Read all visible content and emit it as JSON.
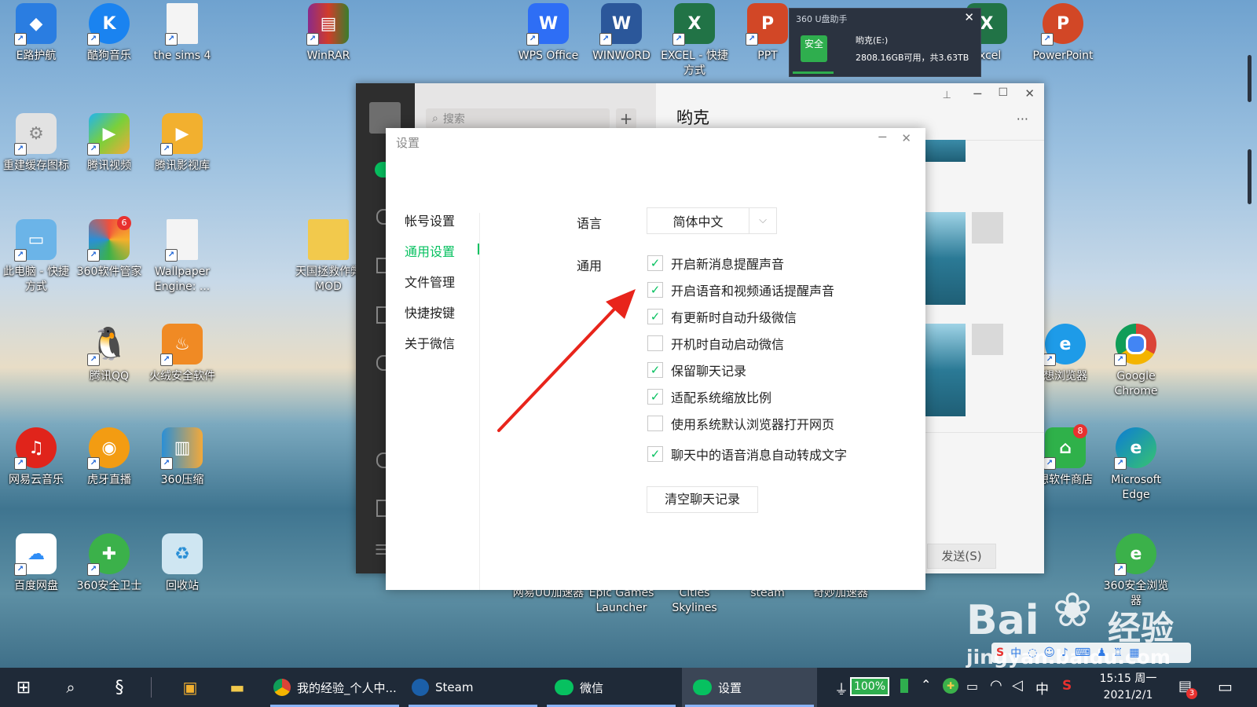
{
  "desktop": {
    "icons": [
      {
        "label": "E路护航",
        "color": "#2a7de1"
      },
      {
        "label": "酷狗音乐",
        "color": "#1a83f0"
      },
      {
        "label": "the sims 4",
        "color": "#eeeeee"
      },
      {
        "label": "WinRAR",
        "color": "#8a2b8a"
      },
      {
        "label": "WPS Office",
        "color": "#2e6ef5"
      },
      {
        "label": "WINWORD",
        "color": "#2b579a"
      },
      {
        "label": "EXCEL - 快捷方式",
        "color": "#217346"
      },
      {
        "label": "PPT",
        "color": "#d24726"
      },
      {
        "label": "excel",
        "color": "#217346"
      },
      {
        "label": "PowerPoint",
        "color": "#d24726"
      },
      {
        "label": "重建缓存图标",
        "color": "#dddddd"
      },
      {
        "label": "腾讯视频",
        "color": "#22b4ef"
      },
      {
        "label": "腾讯影视库",
        "color": "#f2b02f"
      },
      {
        "label": "此电脑 - 快捷方式",
        "color": "#6bb4e8"
      },
      {
        "label": "360软件管家",
        "color": "#3bb14a"
      },
      {
        "label": "Wallpaper Engine: ...",
        "color": "#eeeeee"
      },
      {
        "label": "天国拯救作弊MOD",
        "color": "#f2c94c"
      },
      {
        "label": "腾讯QQ",
        "color": "#111111"
      },
      {
        "label": "火绒安全软件",
        "color": "#f08a24"
      },
      {
        "label": "网易云音乐",
        "color": "#e0241b"
      },
      {
        "label": "虎牙直播",
        "color": "#f39c12"
      },
      {
        "label": "360压缩",
        "color": "#2a8fd6"
      },
      {
        "label": "百度网盘",
        "color": "#2f8df6"
      },
      {
        "label": "360安全卫士",
        "color": "#3bb14a"
      },
      {
        "label": "回收站",
        "color": "#cfe6f2"
      },
      {
        "label": "想浏览器",
        "color": "#1e9be8"
      },
      {
        "label": "Google Chrome",
        "color": "#db4437"
      },
      {
        "label": "想软件商店",
        "color": "#2fb14a"
      },
      {
        "label": "Microsoft Edge",
        "color": "#0c7cd5"
      },
      {
        "label": "360安全浏览器",
        "color": "#3bb14a"
      },
      {
        "label": "网易UU加速器",
        "color": "#2b8cf0"
      },
      {
        "label": "Epic Games Launcher",
        "color": "#2a2a2a"
      },
      {
        "label": "Cities Skylines",
        "color": "#2f7fd0"
      },
      {
        "label": "steam",
        "color": "#1b2838"
      },
      {
        "label": "奇妙加速器",
        "color": "#7f5af0"
      }
    ],
    "badges": {
      "soft_manager": "6",
      "lenovo_store": "8"
    }
  },
  "popup_360": {
    "title": "360 U盘助手",
    "safe_label": "安全",
    "drive": "哟克(E:)",
    "usage": "2808.16GB可用，共3.63TB"
  },
  "wechat": {
    "search_placeholder": "搜索",
    "add_button": "+",
    "chat_title": "哟克",
    "more": "···",
    "send_button": "发送(S)"
  },
  "settings": {
    "title": "设置",
    "nav": [
      "帐号设置",
      "通用设置",
      "文件管理",
      "快捷按键",
      "关于微信"
    ],
    "active_nav": 1,
    "language_label": "语言",
    "language_value": "简体中文",
    "general_label": "通用",
    "options": [
      {
        "label": "开启新消息提醒声音",
        "checked": true
      },
      {
        "label": "开启语音和视频通话提醒声音",
        "checked": true
      },
      {
        "label": "有更新时自动升级微信",
        "checked": true
      },
      {
        "label": "开机时自动启动微信",
        "checked": false
      },
      {
        "label": "保留聊天记录",
        "checked": true
      },
      {
        "label": "适配系统缩放比例",
        "checked": true
      },
      {
        "label": "使用系统默认浏览器打开网页",
        "checked": false
      },
      {
        "label": "聊天中的语音消息自动转成文字",
        "checked": true
      }
    ],
    "clear_button": "清空聊天记录"
  },
  "taskbar": {
    "items": [
      "我的经验_个人中...",
      "Steam",
      "微信",
      "设置"
    ],
    "battery": "100%",
    "ime": "中",
    "time": "15:15 周一",
    "date": "2021/2/1",
    "notif_count": "3"
  },
  "watermark": {
    "brand": "Bai",
    "brand_cn": "经验",
    "url": "jingyan.baidu.com"
  }
}
